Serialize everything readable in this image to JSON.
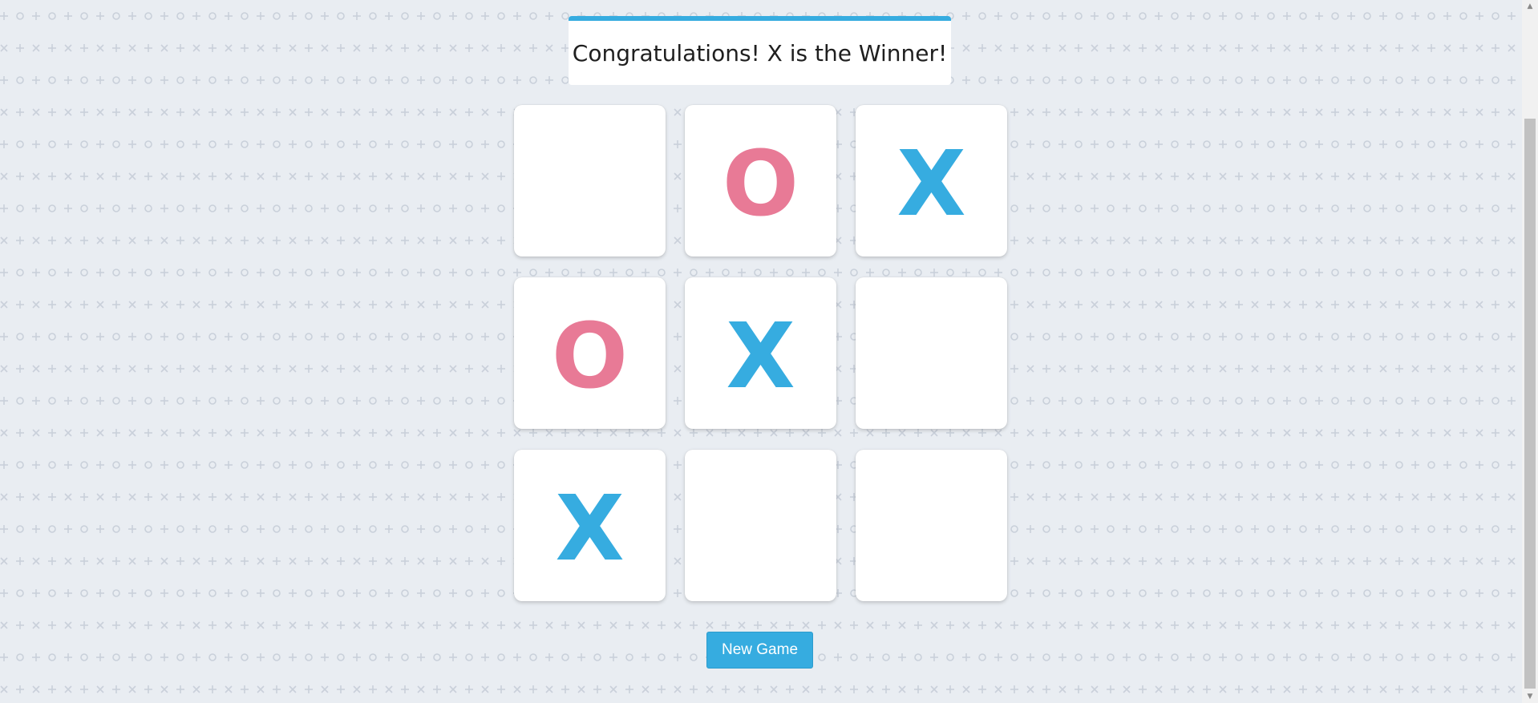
{
  "status": {
    "message": "Congratulations! X is the Winner!"
  },
  "board": {
    "cells": [
      "",
      "O",
      "X",
      "O",
      "X",
      "",
      "X",
      "",
      ""
    ]
  },
  "controls": {
    "new_game_label": "New Game"
  },
  "colors": {
    "accent": "#36ace0",
    "x_mark": "#36ace0",
    "o_mark": "#e87a96",
    "background": "#e9edf2",
    "pattern": "#c9d0da"
  }
}
